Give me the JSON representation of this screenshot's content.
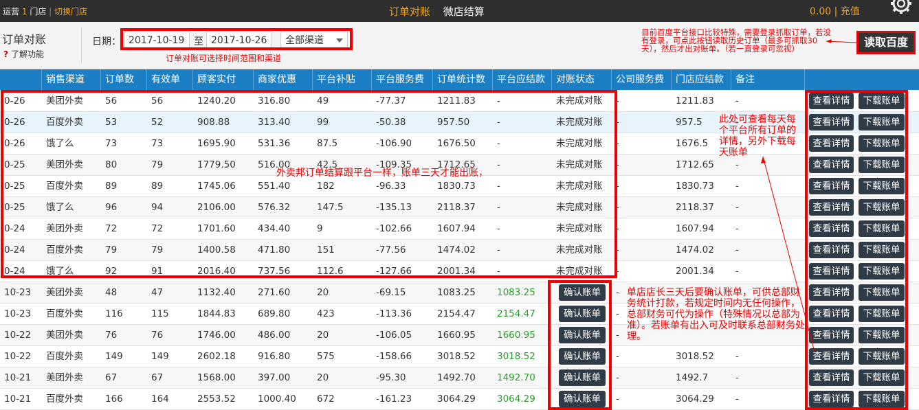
{
  "topbar": {
    "store_prefix": "运营",
    "store_count": "1",
    "store_suffix": "门店",
    "switch_label": "切换门店",
    "nav_active": "订单对账",
    "nav_other": "微店结算",
    "balance": "0.00",
    "recharge": "充值"
  },
  "subbar": {
    "title": "订单对账",
    "learn": "了解功能",
    "date_label": "日期：",
    "date_from": "2017-10-19",
    "date_sep": "至",
    "date_to": "2017-10-26",
    "channel": "全部渠道",
    "read_baidu": "读取百度"
  },
  "annotations": {
    "date_note": "订单对账可选择时间范围和渠道",
    "baidu_note": "目前百度平台接口比较特殊，需要登录抓取订单，若没有登录，可点此按钮读取历史订单（最多可抓取30天），然后才出对账单。（若一直登录可忽视）",
    "waimai_note": "外卖邦订单结算跟平台一样，账单三天才能出账，",
    "detail_note": "此处可查看每天每个平台所有订单的详情，另外下载每天账单",
    "confirm_note": "单店店长三天后要确认账单，可供总部财务统计打款，若规定时间内无任何操作，总部财务可代为操作（特殊情况以总部为准）。若账单有出入可及时联系总部财务处理。"
  },
  "table": {
    "headers": [
      "销售渠道",
      "订单数",
      "有效单",
      "顾客实付",
      "商家优惠",
      "平台补贴",
      "平台服务费",
      "订单统计数",
      "平台应结款",
      "对账状态",
      "公司服务费",
      "门店应结款",
      "备注"
    ],
    "view_label": "查看详情",
    "download_label": "下载账单",
    "confirm_label": "确认账单",
    "rows": [
      {
        "date": "0-26",
        "channel": "美团外卖",
        "orders": "56",
        "valid": "56",
        "paid": "1240.20",
        "discount": "316.80",
        "subsidy": "49",
        "fee": "-77.37",
        "stat": "1211.83",
        "settle": "-",
        "status": "未完成对账",
        "company_fee": "-",
        "store": "1211.83",
        "note": "-"
      },
      {
        "date": "0-26",
        "channel": "百度外卖",
        "orders": "53",
        "valid": "52",
        "paid": "908.88",
        "discount": "313.40",
        "subsidy": "99",
        "fee": "-50.38",
        "stat": "957.50",
        "settle": "-",
        "status": "未完成对账",
        "company_fee": "-",
        "store": "957.5",
        "note": "-"
      },
      {
        "date": "0-26",
        "channel": "饿了么",
        "orders": "73",
        "valid": "73",
        "paid": "1695.90",
        "discount": "531.36",
        "subsidy": "87.5",
        "fee": "-106.90",
        "stat": "1676.50",
        "settle": "-",
        "status": "未完成对账",
        "company_fee": "-",
        "store": "1676.5",
        "note": "-"
      },
      {
        "date": "0-25",
        "channel": "美团外卖",
        "orders": "80",
        "valid": "79",
        "paid": "1779.50",
        "discount": "516.00",
        "subsidy": "42.5",
        "fee": "-109.35",
        "stat": "1712.65",
        "settle": "-",
        "status": "未完成对账",
        "company_fee": "-",
        "store": "1712.65",
        "note": "-"
      },
      {
        "date": "0-25",
        "channel": "百度外卖",
        "orders": "89",
        "valid": "89",
        "paid": "1745.06",
        "discount": "551.40",
        "subsidy": "182",
        "fee": "-96.33",
        "stat": "1830.73",
        "settle": "-",
        "status": "未完成对账",
        "company_fee": "-",
        "store": "1830.73",
        "note": "-"
      },
      {
        "date": "0-25",
        "channel": "饿了么",
        "orders": "96",
        "valid": "94",
        "paid": "2106.00",
        "discount": "576.32",
        "subsidy": "147.5",
        "fee": "-135.13",
        "stat": "2118.37",
        "settle": "-",
        "status": "未完成对账",
        "company_fee": "-",
        "store": "2118.37",
        "note": "-"
      },
      {
        "date": "0-24",
        "channel": "美团外卖",
        "orders": "72",
        "valid": "72",
        "paid": "1701.60",
        "discount": "434.40",
        "subsidy": "9",
        "fee": "-102.66",
        "stat": "1607.94",
        "settle": "-",
        "status": "未完成对账",
        "company_fee": "-",
        "store": "1607.94",
        "note": "-"
      },
      {
        "date": "0-24",
        "channel": "百度外卖",
        "orders": "79",
        "valid": "79",
        "paid": "1400.58",
        "discount": "471.80",
        "subsidy": "151",
        "fee": "-77.56",
        "stat": "1474.02",
        "settle": "-",
        "status": "未完成对账",
        "company_fee": "-",
        "store": "1474.02",
        "note": "-"
      },
      {
        "date": "0-24",
        "channel": "饿了么",
        "orders": "92",
        "valid": "91",
        "paid": "2016.40",
        "discount": "737.56",
        "subsidy": "112.6",
        "fee": "-127.66",
        "stat": "2001.34",
        "settle": "-",
        "status": "未完成对账",
        "company_fee": "-",
        "store": "2001.34",
        "note": "-"
      },
      {
        "date": "10-23",
        "channel": "美团外卖",
        "orders": "48",
        "valid": "47",
        "paid": "1132.40",
        "discount": "271.60",
        "subsidy": "20",
        "fee": "-69.15",
        "stat": "1083.25",
        "settle": "1083.25",
        "status": "",
        "company_fee": "-",
        "store": "",
        "note": ""
      },
      {
        "date": "10-23",
        "channel": "百度外卖",
        "orders": "116",
        "valid": "115",
        "paid": "1844.83",
        "discount": "689.80",
        "subsidy": "423",
        "fee": "-113.36",
        "stat": "2154.47",
        "settle": "2154.47",
        "status": "",
        "company_fee": "-",
        "store": "",
        "note": ""
      },
      {
        "date": "10-22",
        "channel": "美团外卖",
        "orders": "76",
        "valid": "76",
        "paid": "1746.00",
        "discount": "486.00",
        "subsidy": "20",
        "fee": "-106.05",
        "stat": "1660.95",
        "settle": "1660.95",
        "status": "",
        "company_fee": "-",
        "store": "",
        "note": ""
      },
      {
        "date": "10-22",
        "channel": "百度外卖",
        "orders": "149",
        "valid": "149",
        "paid": "2602.18",
        "discount": "916.80",
        "subsidy": "575",
        "fee": "-158.66",
        "stat": "3018.52",
        "settle": "3018.52",
        "status": "",
        "company_fee": "-",
        "store": "3018.52",
        "note": "-"
      },
      {
        "date": "10-21",
        "channel": "美团外卖",
        "orders": "67",
        "valid": "67",
        "paid": "1568.00",
        "discount": "397.00",
        "subsidy": "20",
        "fee": "-95.30",
        "stat": "1492.70",
        "settle": "1492.70",
        "status": "",
        "company_fee": "-",
        "store": "1492.7",
        "note": "-"
      },
      {
        "date": "10-21",
        "channel": "百度外卖",
        "orders": "166",
        "valid": "164",
        "paid": "2553.52",
        "discount": "1000.40",
        "subsidy": "672",
        "fee": "-161.23",
        "stat": "3064.29",
        "settle": "3064.29",
        "status": "",
        "company_fee": "-",
        "store": "3064.29",
        "note": "-"
      }
    ]
  },
  "colors": {
    "header_blue": "#1a7fc4",
    "accent_orange": "#f5a623",
    "annotation_red": "#e00000",
    "settle_green": "#2a9d2a"
  }
}
